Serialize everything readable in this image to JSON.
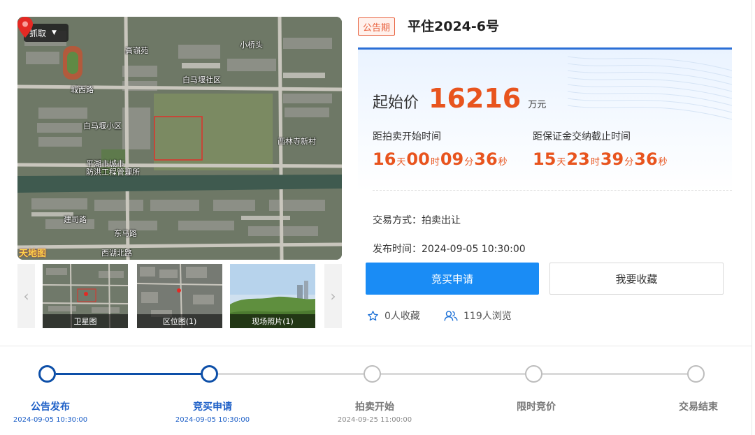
{
  "map": {
    "capture_label": "抓取",
    "labels": [
      "小桥头",
      "高嶺苑",
      "白马堰社区",
      "城西路",
      "白马堰小区",
      "西林寺新村",
      "平湖市城市",
      "防洪工程管理所",
      "建司路",
      "东马路",
      "西湖北路"
    ],
    "logo_text": "天地图"
  },
  "thumbnails": [
    {
      "caption": "卫星图"
    },
    {
      "caption": "区位图(1)"
    },
    {
      "caption": "现场照片(1)"
    }
  ],
  "lot": {
    "status_tag": "公告期",
    "title": "平住2024-6号",
    "price_label": "起始价",
    "price_value": "16216",
    "price_unit": "万元",
    "auction_countdown_label": "距拍卖开始时间",
    "auction_countdown": {
      "days": "16",
      "hours": "00",
      "minutes": "09",
      "seconds": "36"
    },
    "deposit_countdown_label": "距保证金交纳截止时间",
    "deposit_countdown": {
      "days": "15",
      "hours": "23",
      "minutes": "39",
      "seconds": "36"
    },
    "unit_day": "天",
    "unit_hour": "时",
    "unit_minute": "分",
    "unit_second": "秒",
    "trade_mode": "交易方式：拍卖出让",
    "publish_time": "发布时间：2024-09-05 10:30:00"
  },
  "actions": {
    "apply_label": "竞买申请",
    "favorite_label": "我要收藏",
    "favorites_count": "0人收藏",
    "views_count": "119人浏览"
  },
  "steps": [
    {
      "label": "公告发布",
      "date": "2024-09-05 10:30:00",
      "status": "done"
    },
    {
      "label": "竞买申请",
      "date": "2024-09-05 10:30:00",
      "status": "done"
    },
    {
      "label": "拍卖开始",
      "date": "2024-09-25 11:00:00",
      "status": "todo"
    },
    {
      "label": "限时竞价",
      "date": "",
      "status": "todo"
    },
    {
      "label": "交易结束",
      "date": "",
      "status": "todo"
    }
  ],
  "colors": {
    "accent_blue": "#1a8cf5",
    "progress_blue": "#0d4fa8",
    "price_orange": "#e8541e",
    "tag_orange": "#e8603c"
  }
}
